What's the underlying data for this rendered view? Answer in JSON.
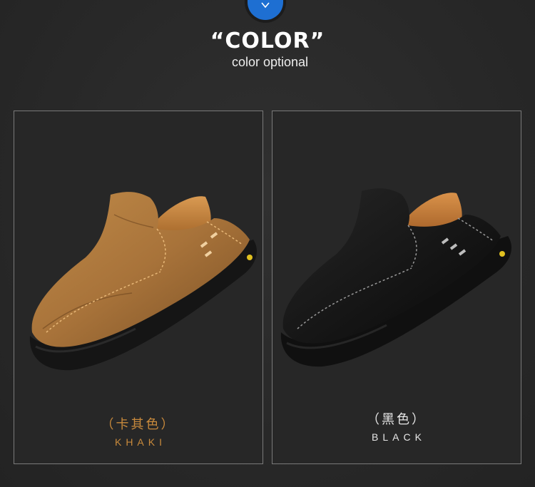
{
  "header": {
    "badge_icon": "chevron-down-icon",
    "title": "“COLOR”",
    "subtitle": "color optional"
  },
  "options": [
    {
      "name_cn": "（卡其色）",
      "name_en": "KHAKI",
      "color": "#b07a3a"
    },
    {
      "name_cn": "（黑色）",
      "name_en": "BLACK",
      "color": "#141414"
    }
  ],
  "colors": {
    "background": "#2a2a2a",
    "accent_blue": "#1e6fd2",
    "khaki_text": "#c98a3c",
    "black_text": "#e6e6e6"
  }
}
